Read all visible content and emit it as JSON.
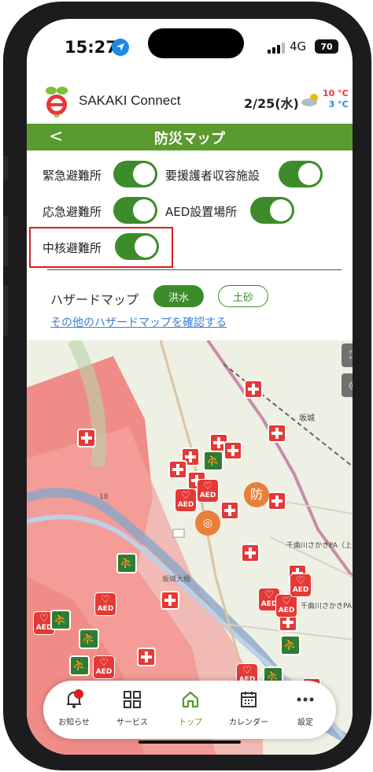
{
  "status_bar": {
    "time": "15:27",
    "network": "4G",
    "battery": "70"
  },
  "app_header": {
    "app_name": "SAKAKI Connect",
    "date": "2/25(水)",
    "temp_high": "10 °C",
    "temp_low": "3 °C",
    "weather_icon": "cloud-sun-icon"
  },
  "page": {
    "back_symbol": "<",
    "title": "防災マップ"
  },
  "toggles": {
    "emergency_shelter": {
      "label": "緊急避難所",
      "on": true
    },
    "care_shelter": {
      "label": "要援護者収容施設",
      "on": true
    },
    "temporary_shelter": {
      "label": "応急避難所",
      "on": true
    },
    "aed_location": {
      "label": "AED設置場所",
      "on": true
    },
    "core_shelter": {
      "label": "中核避難所",
      "on": true
    }
  },
  "hazard": {
    "label": "ハザードマップ",
    "chip_flood": "洪水",
    "chip_landslide": "土砂",
    "active": "洪水",
    "more_link": "その他のハザードマップを確認する"
  },
  "map": {
    "marker_aed_text": "AED",
    "marker_bosai_text": "防",
    "marker_evac_text": "⛹",
    "map_labels": [
      "坂城",
      "千曲川さかきPA（上り）",
      "千曲川さかきPA（下り）",
      "18",
      "坂城大橋"
    ],
    "fullscreen_icon": "fullscreen-icon",
    "locate_icon": "locate-icon"
  },
  "nav": {
    "tabs": [
      {
        "label": "お知らせ",
        "icon": "bell-icon",
        "badge": true
      },
      {
        "label": "サービス",
        "icon": "grid-icon"
      },
      {
        "label": "トップ",
        "icon": "home-icon",
        "active": true
      },
      {
        "label": "カレンダー",
        "icon": "calendar-icon"
      },
      {
        "label": "設定",
        "icon": "more-icon"
      }
    ]
  },
  "colors": {
    "brand_green": "#5b9a2e",
    "toggle_green": "#3d8c2b",
    "highlight_red": "#e01e1e",
    "marker_red": "#e53935",
    "link_blue": "#3a7fd0",
    "flood_zone": "#f07a78"
  }
}
